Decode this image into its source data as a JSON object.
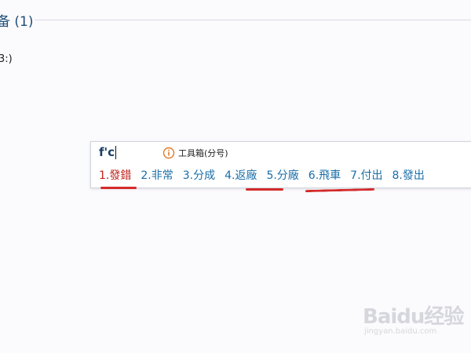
{
  "page": {
    "heading": "备 (1)",
    "body_text": "3:)"
  },
  "ime": {
    "input": "f'c",
    "toolbox_label": "工具箱(分号)",
    "candidates": [
      {
        "label": "1.發錯",
        "selected": true
      },
      {
        "label": "2.非常",
        "selected": false
      },
      {
        "label": "3.分成",
        "selected": false
      },
      {
        "label": "4.返廠",
        "selected": false
      },
      {
        "label": "5.分廠",
        "selected": false
      },
      {
        "label": "6.飛車",
        "selected": false
      },
      {
        "label": "7.付出",
        "selected": false
      },
      {
        "label": "8.發出",
        "selected": false
      }
    ]
  },
  "watermark": {
    "logo": "Baidu经验",
    "url": "jingyan.baidu.com"
  },
  "colors": {
    "candidate": "#1a6ea8",
    "selected_candidate": "#c0241d",
    "annotation_marker": "#d42a2a"
  }
}
